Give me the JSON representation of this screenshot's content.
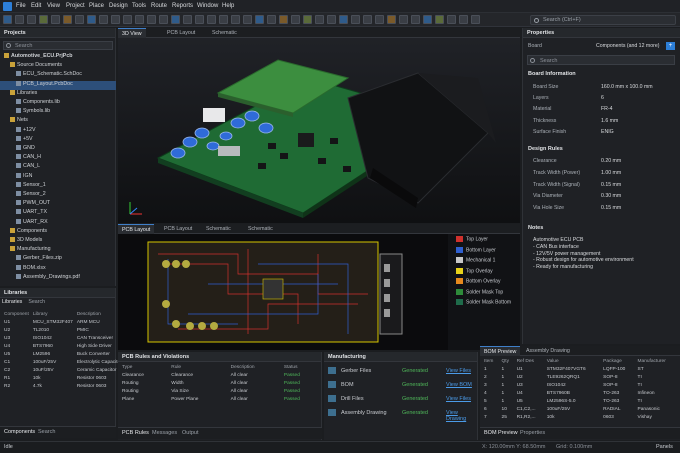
{
  "menubar": {
    "items": [
      "File",
      "Edit",
      "View",
      "Project",
      "Place",
      "Design",
      "Tools",
      "Route",
      "Reports",
      "Window",
      "Help"
    ],
    "search_placeholder": "Search (Ctrl+F)"
  },
  "projects": {
    "title": "Projects",
    "search_placeholder": "Search",
    "tree": [
      {
        "label": "Automotive_ECU.PrjPcb",
        "indent": 0,
        "bold": true
      },
      {
        "label": "Source Documents",
        "indent": 1
      },
      {
        "label": "ECU_Schematic.SchDoc",
        "indent": 2
      },
      {
        "label": "PCB_Layout.PcbDoc",
        "indent": 2,
        "selected": true
      },
      {
        "label": "Libraries",
        "indent": 1
      },
      {
        "label": "Components.lib",
        "indent": 2
      },
      {
        "label": "Symbols.lib",
        "indent": 2
      },
      {
        "label": "Nets",
        "indent": 1
      },
      {
        "label": "+12V",
        "indent": 2
      },
      {
        "label": "+5V",
        "indent": 2
      },
      {
        "label": "GND",
        "indent": 2
      },
      {
        "label": "CAN_H",
        "indent": 2
      },
      {
        "label": "CAN_L",
        "indent": 2
      },
      {
        "label": "IGN",
        "indent": 2
      },
      {
        "label": "Sensor_1",
        "indent": 2
      },
      {
        "label": "Sensor_2",
        "indent": 2
      },
      {
        "label": "PWM_OUT",
        "indent": 2
      },
      {
        "label": "UART_TX",
        "indent": 2
      },
      {
        "label": "UART_RX",
        "indent": 2
      },
      {
        "label": "Components",
        "indent": 1
      },
      {
        "label": "3D Models",
        "indent": 1
      },
      {
        "label": "Manufacturing",
        "indent": 1
      },
      {
        "label": "Gerber_Files.zip",
        "indent": 2
      },
      {
        "label": "BOM.xlsx",
        "indent": 2
      },
      {
        "label": "Assembly_Drawings.pdf",
        "indent": 2
      }
    ]
  },
  "libraries": {
    "title": "Libraries",
    "tabs": [
      "Libraries",
      "Search"
    ],
    "headers": [
      "Component",
      "Library",
      "Description"
    ],
    "rows": [
      [
        "U1",
        "MCU_STM32F407",
        "ARM MCU"
      ],
      [
        "U2",
        "TL2010",
        "PMIC"
      ],
      [
        "U3",
        "ISO1042",
        "CAN Transceiver"
      ],
      [
        "U4",
        "BTS7960",
        "High Side Driver"
      ],
      [
        "U5",
        "LM2596",
        "Buck Converter"
      ],
      [
        "C1",
        "100uF/25V",
        "Electrolytic Capacitor"
      ],
      [
        "C2",
        "10uF/25V",
        "Ceramic Capacitor"
      ],
      [
        "R1",
        "10k",
        "Resistor 0603"
      ],
      [
        "R2",
        "4.7k",
        "Resistor 0603"
      ]
    ],
    "bottom_tabs": [
      "Components",
      "Search"
    ]
  },
  "editor": {
    "tabs": [
      "3D View",
      "PCB Layout",
      "Schematic"
    ],
    "pcb_tabs": [
      "PCB Layout",
      "PCB Layout",
      "Schematic",
      "Schematic"
    ]
  },
  "layers": [
    {
      "name": "Top Layer",
      "color": "#d0312d"
    },
    {
      "name": "Bottom Layer",
      "color": "#2f5fd0"
    },
    {
      "name": "Mechanical 1",
      "color": "#c8c8c8"
    },
    {
      "name": "Top Overlay",
      "color": "#e8d21a"
    },
    {
      "name": "Bottom Overlay",
      "color": "#e68a1e"
    },
    {
      "name": "Solder Mask Top",
      "color": "#2e8b3a"
    },
    {
      "name": "Solder Mask Bottom",
      "color": "#1f6b4a"
    }
  ],
  "rules": {
    "title": "PCB Rules and Violations",
    "headers": [
      "Type",
      "Rule",
      "Description",
      "Status"
    ],
    "rows": [
      [
        "Clearance",
        "Clearance",
        "All clear",
        "Passed"
      ],
      [
        "Routing",
        "Width",
        "All clear",
        "Passed"
      ],
      [
        "Routing",
        "Via Size",
        "All clear",
        "Passed"
      ],
      [
        "Plane",
        "Power Plane",
        "All clear",
        "Passed"
      ]
    ],
    "bottom_tabs": [
      "PCB Rules",
      "Messages",
      "Output"
    ]
  },
  "manufacturing": {
    "title": "Manufacturing",
    "rows": [
      {
        "name": "Gerber Files",
        "status": "Generated",
        "link": "View Files"
      },
      {
        "name": "BOM",
        "status": "Generated",
        "link": "View BOM"
      },
      {
        "name": "Drill Files",
        "status": "Generated",
        "link": "View Files"
      },
      {
        "name": "Assembly Drawing",
        "status": "Generated",
        "link": "View Drawing"
      }
    ]
  },
  "bom": {
    "tabs": [
      "BOM Preview",
      "Assembly Drawing"
    ],
    "headers": [
      "Item",
      "Qty",
      "Ref Des",
      "Value",
      "Package",
      "Manufacturer"
    ],
    "rows": [
      [
        "1",
        "1",
        "U1",
        "STM32F407VGT6",
        "LQFP-100",
        "ST"
      ],
      [
        "2",
        "1",
        "U2",
        "TLE9262QRQ1",
        "SOP-8",
        "TI"
      ],
      [
        "3",
        "1",
        "U3",
        "ISO1042",
        "SOP-8",
        "TI"
      ],
      [
        "4",
        "1",
        "U4",
        "BTS7960B",
        "TO-263",
        "Infineon"
      ],
      [
        "5",
        "1",
        "U5",
        "LM2596S-5.0",
        "TO-263",
        "TI"
      ],
      [
        "6",
        "10",
        "C1,C2,...",
        "100uF/25V",
        "RADIAL",
        "Panasonic"
      ],
      [
        "7",
        "25",
        "R1,R2,...",
        "10k",
        "0603",
        "Vishay"
      ]
    ],
    "bottom_tabs": [
      "BOM Preview",
      "Properties"
    ]
  },
  "properties": {
    "title": "Properties",
    "board_label": "Board",
    "board_value": "Components (and 12 more)",
    "search_placeholder": "Search",
    "board_info_title": "Board Information",
    "board_info": [
      [
        "Board Size",
        "160.0 mm x 100.0 mm"
      ],
      [
        "Layers",
        "6"
      ],
      [
        "Material",
        "FR-4"
      ],
      [
        "Thickness",
        "1.6 mm"
      ],
      [
        "Surface Finish",
        "ENIG"
      ]
    ],
    "rules_title": "Design Rules",
    "rules": [
      [
        "Clearance",
        "0.20 mm"
      ],
      [
        "Track Width (Power)",
        "1.00 mm"
      ],
      [
        "Track Width (Signal)",
        "0.15 mm"
      ],
      [
        "Via Diameter",
        "0.30 mm"
      ],
      [
        "Via Hole Size",
        "0.15 mm"
      ]
    ],
    "notes_title": "Notes",
    "notes": [
      "Automotive ECU PCB",
      "- CAN Bus interface",
      "- 12V/5V power management",
      "- Robust design for automotive environment",
      "- Ready for manufacturing"
    ]
  },
  "statusbar": {
    "left": "Idle",
    "coords": "X: 120.00mm  Y: 68.50mm",
    "grid": "Grid: 0.100mm",
    "right": "Panels"
  }
}
